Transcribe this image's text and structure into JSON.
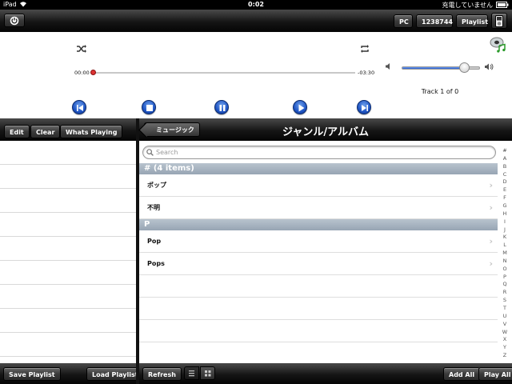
{
  "status_bar": {
    "device": "iPad",
    "time": "0:02",
    "charging": "充電していません"
  },
  "top_bar": {
    "server_label": "PC",
    "id_label": "1238744",
    "playlist_label": "Playlist"
  },
  "player": {
    "elapsed": "00:00",
    "remaining": "-03:30",
    "track_info": "Track 1 of 0",
    "progress": 0.0,
    "volume": 0.8
  },
  "left_pane": {
    "edit_label": "Edit",
    "clear_label": "Clear",
    "whats_playing_label": "Whats Playing",
    "save_playlist_label": "Save Playlist",
    "load_playlist_label": "Load Playlist"
  },
  "right_pane": {
    "back_label": "ミュージック",
    "title": "ジャンル/アルバム",
    "search_placeholder": "Search",
    "sections": [
      {
        "header": "# (4 items)",
        "items": [
          "ポップ",
          "不明"
        ]
      },
      {
        "header": "P",
        "items": [
          "Pop",
          "Pops"
        ]
      }
    ],
    "index": [
      "#",
      "A",
      "B",
      "C",
      "D",
      "E",
      "F",
      "G",
      "H",
      "I",
      "J",
      "K",
      "L",
      "M",
      "N",
      "O",
      "P",
      "Q",
      "R",
      "S",
      "T",
      "U",
      "V",
      "W",
      "X",
      "Y",
      "Z"
    ],
    "refresh_label": "Refresh",
    "add_all_label": "Add All",
    "play_all_label": "Play All"
  },
  "colors": {
    "accent_blue": "#2a5fd0",
    "section_header": "#a3b0bd"
  }
}
